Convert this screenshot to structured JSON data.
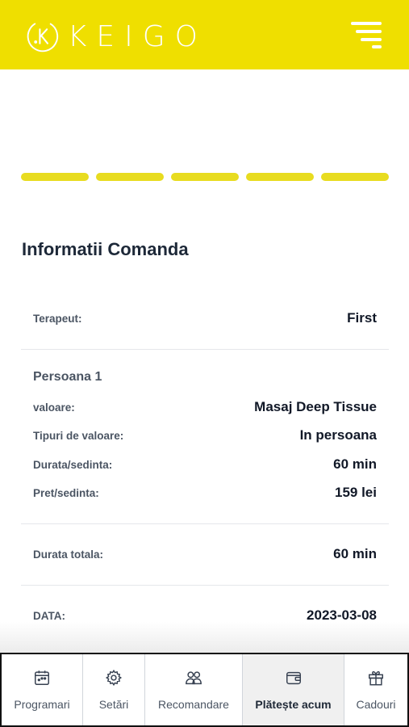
{
  "header": {
    "logo_text": "KEIGO",
    "brand_color": "#efdf00"
  },
  "progress": {
    "steps_total": 5,
    "steps_completed": 5
  },
  "order": {
    "title": "Informatii Comanda",
    "therapist_label": "Terapeut:",
    "therapist_value": "First",
    "person_heading": "Persoana 1",
    "value_label": "valoare:",
    "value_value": "Masaj Deep Tissue",
    "type_label": "Tipuri de valoare:",
    "type_value": "In persoana",
    "duration_label": "Durata/sedinta:",
    "duration_value": "60 min",
    "price_label": "Pret/sedinta:",
    "price_value": "159 lei",
    "total_duration_label": "Durata totala:",
    "total_duration_value": "60 min",
    "date_label": "DATA:",
    "date_value": "2023-03-08"
  },
  "bottom_nav": [
    {
      "label": "Programari",
      "icon": "calendar-icon"
    },
    {
      "label": "Setări",
      "icon": "gear-icon"
    },
    {
      "label": "Recomandare",
      "icon": "users-icon"
    },
    {
      "label": "Plătește acum",
      "icon": "wallet-icon",
      "active": true
    },
    {
      "label": "Cadouri",
      "icon": "gift-icon"
    }
  ]
}
